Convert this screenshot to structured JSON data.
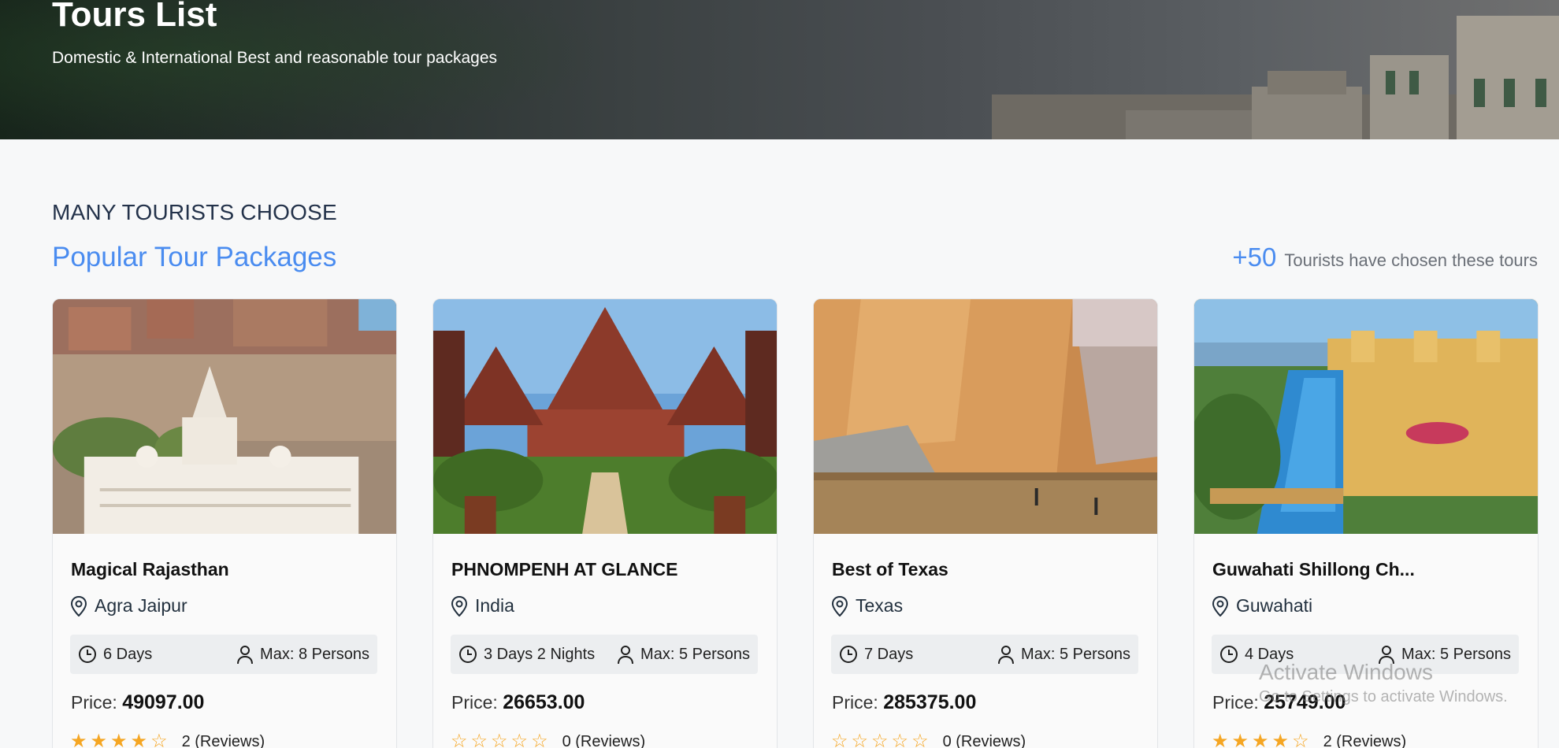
{
  "hero": {
    "title": "Tours List",
    "subtitle": "Domestic & International Best and reasonable tour packages"
  },
  "section": {
    "eyebrow": "MANY TOURISTS CHOOSE",
    "title": "Popular Tour Packages",
    "count": "+50",
    "count_text": "Tourists have chosen these tours"
  },
  "tours": [
    {
      "name": "Magical Rajasthan",
      "location": "Agra Jaipur",
      "duration": "6 Days",
      "max": "Max: 8 Persons",
      "price_label": "Price:",
      "price": "49097.00",
      "rating": 4,
      "reviews": "2 (Reviews)",
      "image": "rajasthan-palace"
    },
    {
      "name": "PHNOMPENH AT GLANCE",
      "location": "India",
      "duration": "3 Days 2 Nights",
      "max": "Max: 5 Persons",
      "price_label": "Price:",
      "price": "26653.00",
      "rating": 0,
      "reviews": "0 (Reviews)",
      "image": "cambodia-temple"
    },
    {
      "name": "Best of Texas",
      "location": "Texas",
      "duration": "7 Days",
      "max": "Max: 5 Persons",
      "price_label": "Price:",
      "price": "285375.00",
      "rating": 0,
      "reviews": "0 (Reviews)",
      "image": "canyon-river"
    },
    {
      "name": "Guwahati Shillong Ch...",
      "location": "Guwahati",
      "duration": "4 Days",
      "max": "Max: 5 Persons",
      "price_label": "Price:",
      "price": "25749.00",
      "rating": 4,
      "reviews": "2 (Reviews)",
      "image": "lake-palace-pool"
    }
  ],
  "watermark": {
    "line1": "Activate Windows",
    "line2": "Go to Settings to activate Windows."
  },
  "colors": {
    "accent": "#4a8cf0",
    "star": "#f5a623"
  }
}
